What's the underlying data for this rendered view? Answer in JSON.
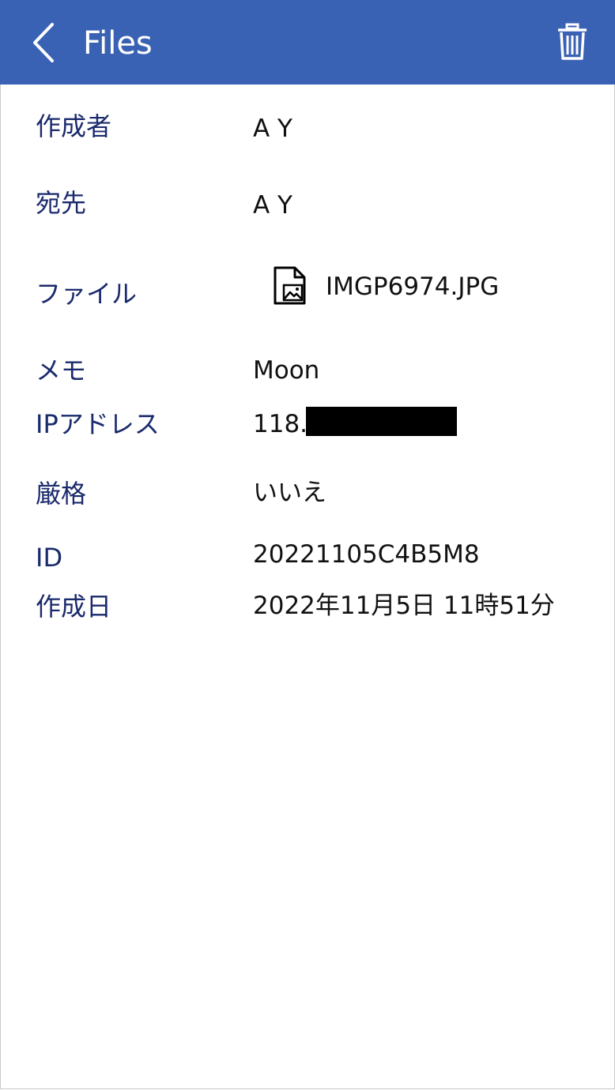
{
  "header": {
    "title": "Files",
    "back_icon": "chevron-left-icon",
    "delete_icon": "trash-icon",
    "color": "#3a62b4"
  },
  "details": {
    "author": {
      "label": "作成者",
      "value": "A Y"
    },
    "recipient": {
      "label": "宛先",
      "value": "A Y"
    },
    "file": {
      "label": "ファイル",
      "value": "IMGP6974.JPG",
      "icon": "image-file-icon"
    },
    "memo": {
      "label": "メモ",
      "value": "Moon"
    },
    "ip": {
      "label": "IPアドレス",
      "value": "118."
    },
    "strict": {
      "label": "厳格",
      "value": "いいえ"
    },
    "id": {
      "label": "ID",
      "value": "20221105C4B5M8"
    },
    "created": {
      "label": "作成日",
      "value": "2022年11月5日 11時51分"
    }
  },
  "colors": {
    "label_text": "#1a2a6c",
    "value_text": "#111111"
  }
}
